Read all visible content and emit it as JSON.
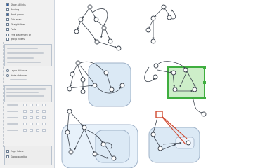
{
  "sidebar": {
    "options": [
      {
        "label": "Show all links",
        "checked": true
      },
      {
        "label": "Routing",
        "checked": false
      },
      {
        "label": "Bend points",
        "checked": true
      },
      {
        "label": "Grid snap",
        "checked": false
      },
      {
        "label": "Straight lines",
        "checked": false
      },
      {
        "label": "Ports",
        "checked": false
      },
      {
        "label": "Free placement of",
        "checked": false
      },
      {
        "label": "group nodes",
        "checked": false
      }
    ],
    "radios": [
      {
        "label": "Layer distance",
        "checked": false
      },
      {
        "label": "Node distance",
        "checked": false
      }
    ],
    "bottom_options": [
      {
        "label": "Edge labels",
        "checked": false
      },
      {
        "label": "Group padding",
        "checked": false
      }
    ]
  },
  "colors": {
    "group_fill": "#dbe9f5",
    "group_stroke": "#9fb2c8",
    "highlight_green": "#3fae3f",
    "highlight_green_fill": "#cdeec9",
    "highlight_red": "#d0492f",
    "edge": "#3f4650"
  }
}
